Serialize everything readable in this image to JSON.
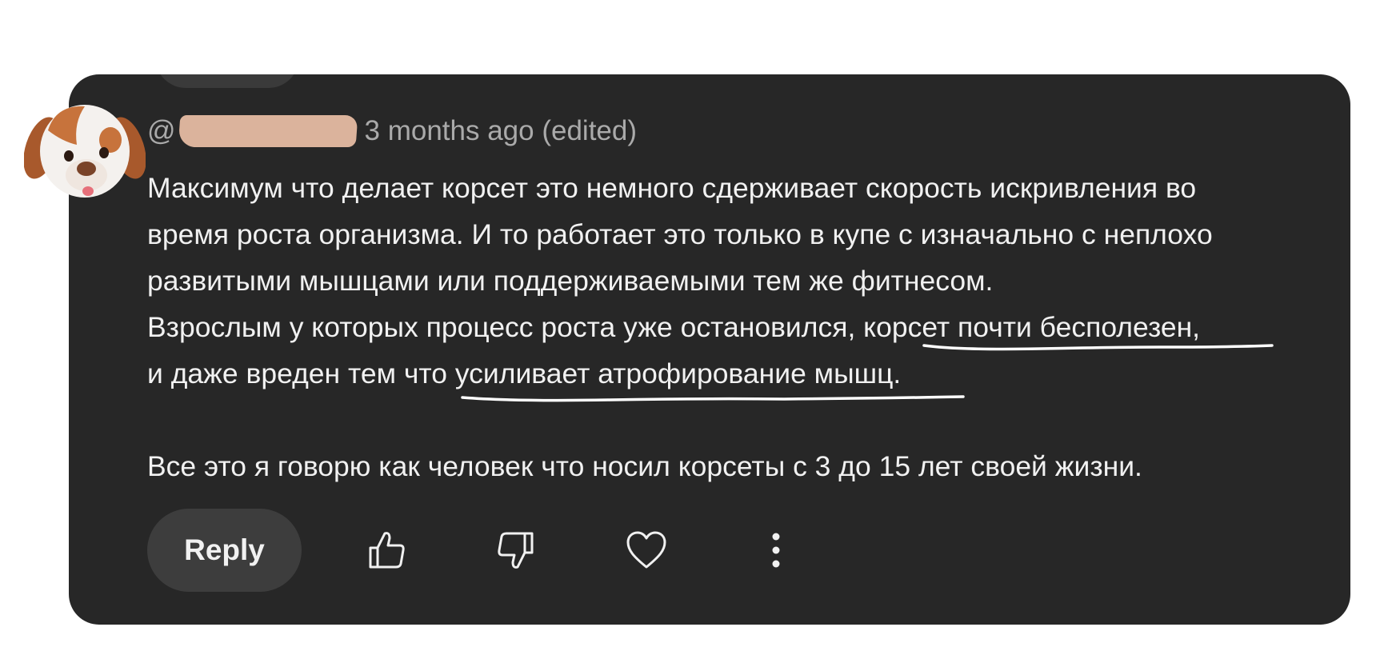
{
  "comment": {
    "author_prefix": "@",
    "timestamp": "3 months ago (edited)",
    "lines": [
      "Максимум что делает корсет это немного сдерживает скорость искривления во",
      "время роста организма. И то работает это только в купе с изначально с неплохо",
      "развитыми мышцами или поддерживаемыми тем же фитнесом.",
      "Взрослым у которых процесс роста уже остановился, корсет почти бесполезен,",
      "и даже вреден тем что усиливает атрофирование мышц.",
      "",
      "Все это я говорю как человек что носил корсеты с 3 до 15 лет своей жизни."
    ]
  },
  "actions": {
    "reply_label": "Reply",
    "like_icon": "thumbs-up-icon",
    "dislike_icon": "thumbs-down-icon",
    "heart_icon": "heart-icon",
    "more_icon": "more-vertical-icon"
  },
  "colors": {
    "card_background": "#272727",
    "text_primary": "#f1f1f1",
    "text_secondary": "#aaaaaa",
    "reply_button": "#3d3d3d",
    "redaction": "#dbb39c",
    "underline": "#ffffff"
  }
}
